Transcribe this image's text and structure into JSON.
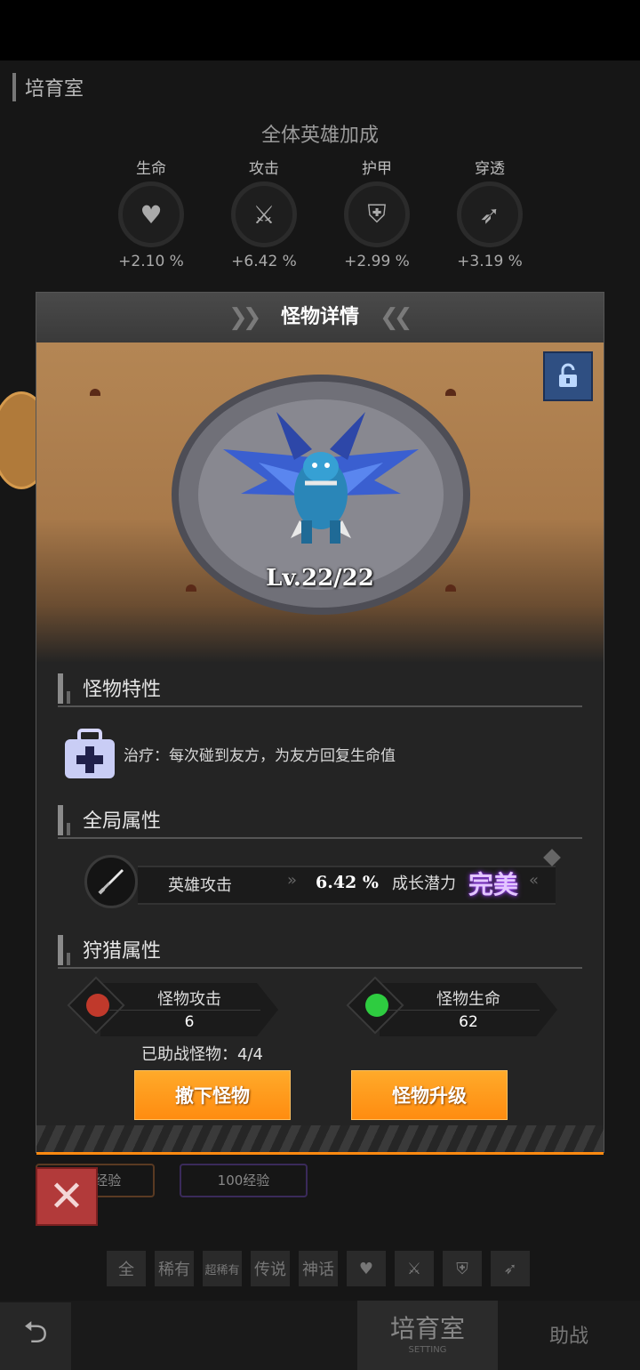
{
  "background": {
    "page_title": "培育室",
    "bonus_heading": "全体英雄加成",
    "stats": [
      {
        "label": "生命",
        "icon": "heart-icon",
        "value": "+2.10 %"
      },
      {
        "label": "攻击",
        "icon": "sword-icon",
        "value": "+6.42 %"
      },
      {
        "label": "护甲",
        "icon": "shield-icon",
        "value": "+2.99 %"
      },
      {
        "label": "穿透",
        "icon": "pierce-icon",
        "value": "+3.19 %"
      }
    ],
    "exp_chips": [
      "100经验",
      "100经验"
    ],
    "filters": [
      "全",
      "稀有",
      "超稀有",
      "传说",
      "神话"
    ],
    "tabs": {
      "active": "培育室",
      "active_sub": "SETTING",
      "other": "助战"
    }
  },
  "modal": {
    "title": "怪物详情",
    "level": "Lv.22/22",
    "sections": {
      "trait": "怪物特性",
      "global": "全局属性",
      "hunt": "狩猎属性"
    },
    "trait_text": "治疗：每次碰到友方，为友方回复生命值",
    "global_attr": {
      "label": "英雄攻击",
      "value": "6.42 %",
      "growth_label": "成长潜力",
      "growth_value": "完美"
    },
    "hunt_attrs": [
      {
        "label": "怪物攻击",
        "value": "6",
        "icon": "attack-icon",
        "color": "#c0392b"
      },
      {
        "label": "怪物生命",
        "value": "62",
        "icon": "hp-shield-icon",
        "color": "#2ecc40"
      }
    ],
    "assist_text": "已助战怪物：4/4",
    "buttons": {
      "remove": "撤下怪物",
      "upgrade": "怪物升级"
    }
  },
  "colors": {
    "accent": "#ff9a1a",
    "lock": "#2f4f82",
    "close": "#b23a3a"
  }
}
